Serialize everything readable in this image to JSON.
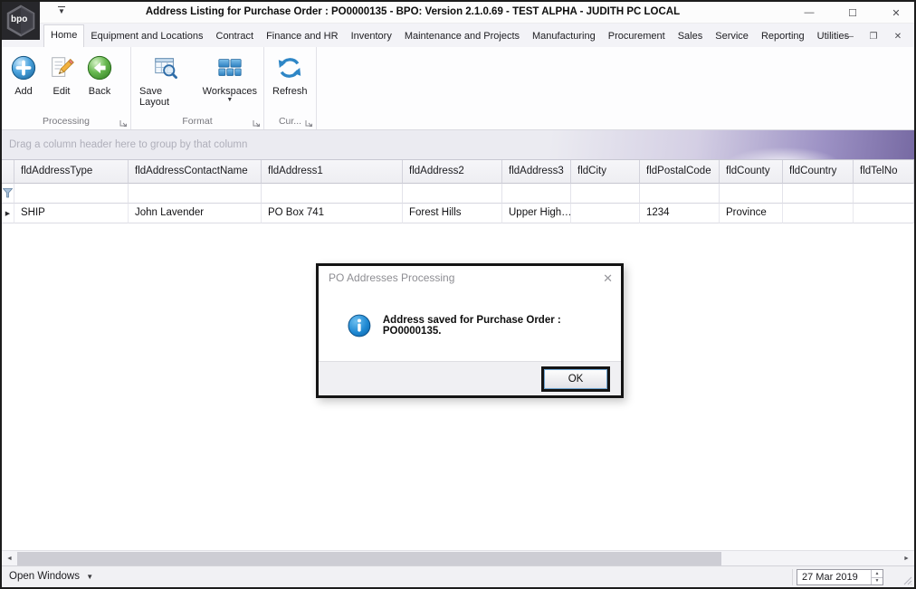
{
  "titlebar": {
    "title": "Address Listing for Purchase Order : PO0000135 - BPO: Version 2.1.0.69 - TEST ALPHA - JUDITH PC LOCAL",
    "logo_text": "bpo"
  },
  "tabs": [
    "Home",
    "Equipment and Locations",
    "Contract",
    "Finance and HR",
    "Inventory",
    "Maintenance and Projects",
    "Manufacturing",
    "Procurement",
    "Sales",
    "Service",
    "Reporting",
    "Utilities"
  ],
  "ribbon": {
    "add": "Add",
    "edit": "Edit",
    "back": "Back",
    "save_layout": "Save Layout",
    "workspaces": "Workspaces",
    "refresh": "Refresh",
    "group_processing": "Processing",
    "group_format": "Format",
    "group_current": "Cur..."
  },
  "grid": {
    "group_by_hint": "Drag a column header here to group by that column",
    "columns": [
      "fldAddressType",
      "fldAddressContactName",
      "fldAddress1",
      "fldAddress2",
      "fldAddress3",
      "fldCity",
      "fldPostalCode",
      "fldCounty",
      "fldCountry",
      "fldTelNo"
    ],
    "row": {
      "cells": [
        "SHIP",
        "John Lavender",
        "PO Box 741",
        "Forest Hills",
        "Upper High…",
        "",
        "1234",
        "Province",
        "",
        ""
      ]
    }
  },
  "dialog": {
    "title": "PO Addresses Processing",
    "message": "Address saved for Purchase Order : PO0000135.",
    "ok": "OK"
  },
  "statusbar": {
    "open_windows": "Open Windows",
    "date": "27 Mar 2019"
  },
  "colors": {
    "accent_blue": "#2e86c6",
    "groupby_purple": "#776aa3",
    "annotation_border": "#141414"
  }
}
